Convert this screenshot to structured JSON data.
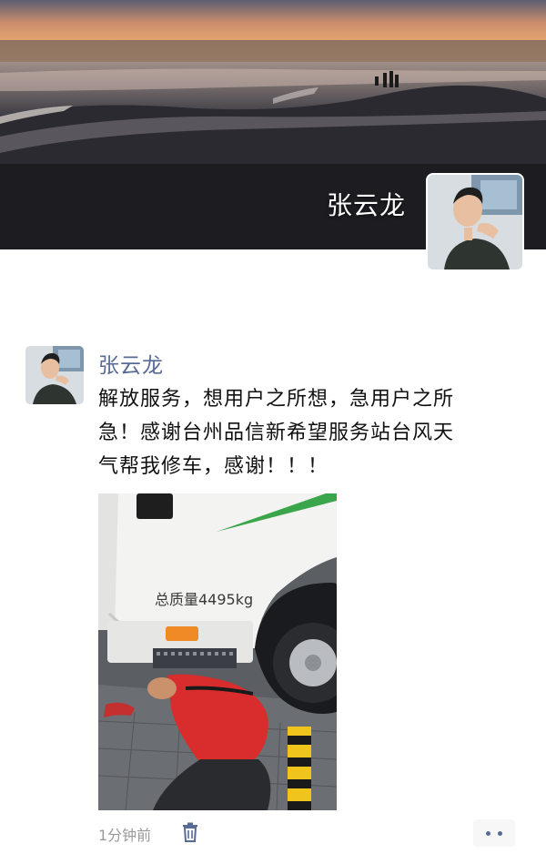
{
  "cover": {
    "name": "张云龙"
  },
  "post": {
    "author": "张云龙",
    "text": "解放服务，想用户之所想，急用户之所\n急！感谢台州品信新希望服务站台风天\n气帮我修车，感谢！！！",
    "photo": {
      "truck_label": "总质量4495kg"
    },
    "time": "1分钟前"
  },
  "icons": {
    "delete": "trash-icon",
    "more": "more-dots-icon"
  },
  "colors": {
    "author_link": "#576b95",
    "meta_gray": "#9a9a9a",
    "truck_stripe": "#3aa54a",
    "shirt_red": "#d92c2c"
  }
}
